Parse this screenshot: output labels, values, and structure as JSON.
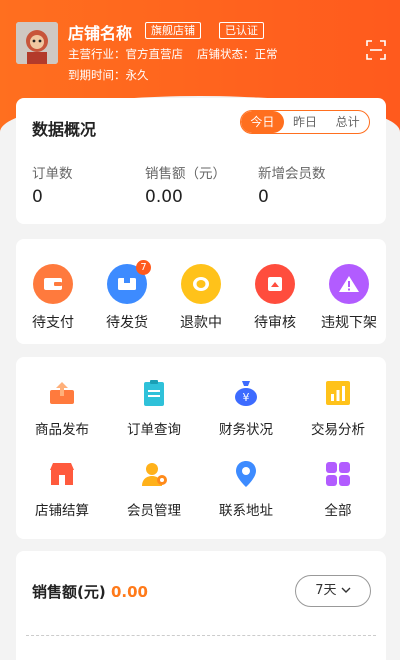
{
  "header": {
    "store_name": "店铺名称",
    "tag_flagship": "旗舰店铺",
    "tag_verified": "已认证",
    "industry_label": "主营行业：",
    "industry_value": "官方直营店",
    "status_label": "店铺状态：",
    "status_value": "正常",
    "expire_label": "到期时间：",
    "expire_value": "永久",
    "scan_icon": "scan-icon",
    "colors": {
      "brand": "#ff6f1f"
    }
  },
  "overview": {
    "title": "数据概况",
    "tabs": [
      {
        "label": "今日",
        "active": true
      },
      {
        "label": "昨日",
        "active": false
      },
      {
        "label": "总计",
        "active": false
      }
    ],
    "stats": [
      {
        "label": "订单数",
        "value": "0"
      },
      {
        "label": "销售额（元）",
        "value": "0.00"
      },
      {
        "label": "新增会员数",
        "value": "0"
      }
    ]
  },
  "orders": [
    {
      "label": "待支付",
      "icon": "wallet-icon",
      "color": "#ff7a3d"
    },
    {
      "label": "待发货",
      "icon": "box-icon",
      "color": "#3d8bff",
      "badge": "7"
    },
    {
      "label": "退款中",
      "icon": "coin-icon",
      "color": "#ffc21a"
    },
    {
      "label": "待审核",
      "icon": "review-icon",
      "color": "#ff4d3d"
    },
    {
      "label": "违规下架",
      "icon": "warning-icon",
      "color": "#b25cff"
    }
  ],
  "tools": [
    {
      "label": "商品发布",
      "icon": "upload-icon",
      "color": "#ff7a3d"
    },
    {
      "label": "订单查询",
      "icon": "clipboard-icon",
      "color": "#2fc1d9"
    },
    {
      "label": "财务状况",
      "icon": "money-bag-icon",
      "color": "#3d6bff"
    },
    {
      "label": "交易分析",
      "icon": "chart-icon",
      "color": "#ffc21a"
    },
    {
      "label": "店铺结算",
      "icon": "store-icon",
      "color": "#ff5a3d"
    },
    {
      "label": "会员管理",
      "icon": "member-icon",
      "color": "#ffb11a"
    },
    {
      "label": "联系地址",
      "icon": "location-icon",
      "color": "#3d8bff"
    },
    {
      "label": "全部",
      "icon": "grid-icon",
      "color": "#b25cff"
    }
  ],
  "sales": {
    "title": "销售额(元)",
    "value": "0.00",
    "range": "7天",
    "range_icon": "chevron-down-icon"
  }
}
